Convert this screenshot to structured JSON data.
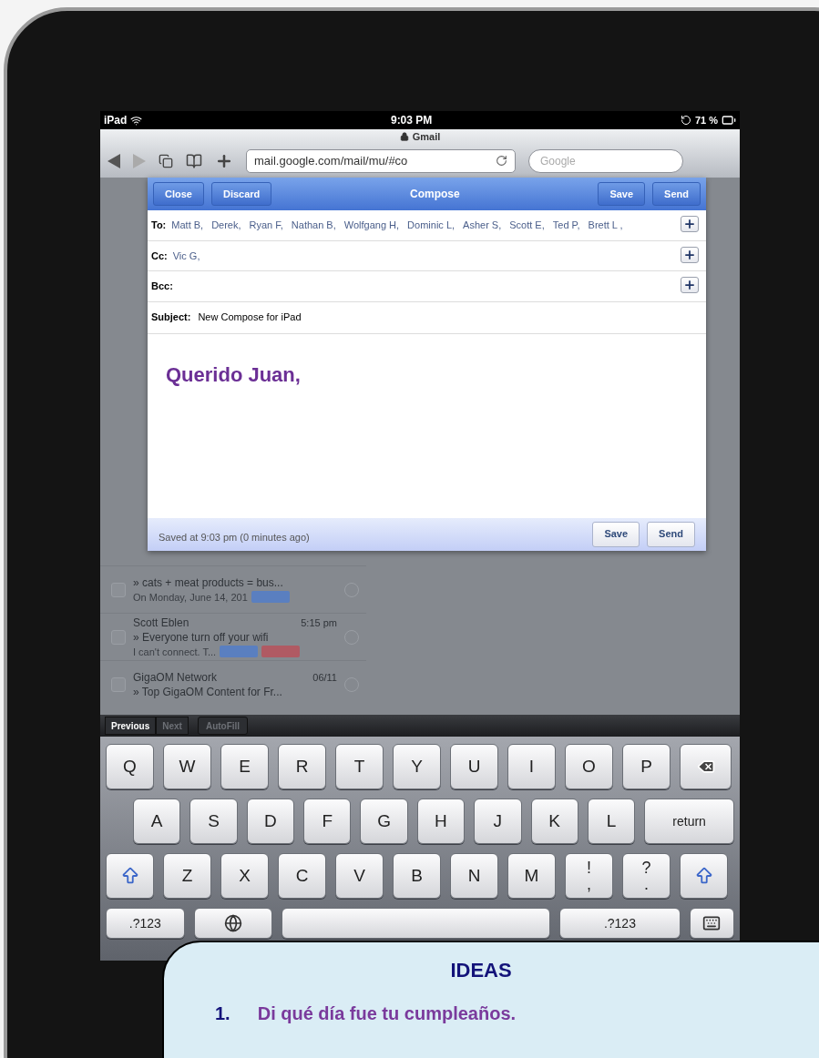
{
  "status_bar": {
    "device": "iPad",
    "time": "9:03 PM",
    "battery": "71 %"
  },
  "browser": {
    "title": "Gmail",
    "url": "mail.google.com/mail/mu/#co",
    "search_placeholder": "Google"
  },
  "compose": {
    "left_buttons": [
      "Close",
      "Discard"
    ],
    "title": "Compose",
    "right_buttons": [
      "Save",
      "Send"
    ],
    "fields": [
      {
        "label": "To:",
        "recipients": [
          "Matt B,",
          "Derek,",
          "Ryan F,",
          "Nathan B,",
          "Wolfgang H,",
          "Dominic L,",
          "Asher S,",
          "Scott E,",
          "Ted P,",
          "Brett L ,"
        ]
      },
      {
        "label": "Cc:",
        "recipients": [
          "Vic G,"
        ]
      },
      {
        "label": "Bcc:"
      }
    ],
    "subject": {
      "label": "Subject:",
      "value": "New Compose for iPad"
    },
    "body": "Querido Juan,",
    "saved_note": "Saved at 9:03 pm (0 minutes ago)",
    "footer_buttons": [
      "Save",
      "Send"
    ]
  },
  "message_list": [
    {
      "checked": false,
      "subject": "» cats + meat products = bus...",
      "snippet": "On Monday, June 14, 201",
      "tags": [
        {
          "color": "#5a7fc0"
        }
      ]
    },
    {
      "checked": false,
      "sender": "Scott Eblen",
      "time": "5:15 pm",
      "subject": "» Everyone turn off your wifi",
      "snippet": "I can't connect. T...",
      "tags": [
        {
          "color": "#5a7fc0"
        },
        {
          "color": "#b05a63"
        }
      ]
    },
    {
      "checked": false,
      "sender": "GigaOM Network",
      "time": "06/11",
      "subject": "» Top GigaOM Content for Fr..."
    }
  ],
  "keyboard_toolbar": [
    {
      "label": "Previous",
      "disabled": false
    },
    {
      "label": "Next",
      "disabled": true
    },
    {
      "label": "AutoFill",
      "disabled": true
    }
  ],
  "keyboard": [
    [
      {
        "kind": "char",
        "label": "Q"
      },
      {
        "kind": "char",
        "label": "W"
      },
      {
        "kind": "char",
        "label": "E"
      },
      {
        "kind": "char",
        "label": "R"
      },
      {
        "kind": "char",
        "label": "T"
      },
      {
        "kind": "char",
        "label": "Y"
      },
      {
        "kind": "char",
        "label": "U"
      },
      {
        "kind": "char",
        "label": "I"
      },
      {
        "kind": "char",
        "label": "O"
      },
      {
        "kind": "char",
        "label": "P"
      },
      {
        "kind": "backspace"
      }
    ],
    [
      {
        "kind": "char",
        "label": "A"
      },
      {
        "kind": "char",
        "label": "S"
      },
      {
        "kind": "char",
        "label": "D"
      },
      {
        "kind": "char",
        "label": "F"
      },
      {
        "kind": "char",
        "label": "G"
      },
      {
        "kind": "char",
        "label": "H"
      },
      {
        "kind": "char",
        "label": "J"
      },
      {
        "kind": "char",
        "label": "K"
      },
      {
        "kind": "char",
        "label": "L"
      },
      {
        "kind": "wide",
        "label": "return"
      }
    ],
    [
      {
        "kind": "shift"
      },
      {
        "kind": "char",
        "label": "Z"
      },
      {
        "kind": "char",
        "label": "X"
      },
      {
        "kind": "char",
        "label": "C"
      },
      {
        "kind": "char",
        "label": "V"
      },
      {
        "kind": "char",
        "label": "B"
      },
      {
        "kind": "char",
        "label": "N"
      },
      {
        "kind": "char",
        "label": "M"
      },
      {
        "kind": "dual",
        "label": "!",
        "sub": ","
      },
      {
        "kind": "dual",
        "label": "?",
        "sub": "."
      },
      {
        "kind": "shift"
      }
    ],
    [
      {
        "kind": "numbers",
        "label": ".?123"
      },
      {
        "kind": "globe"
      },
      {
        "kind": "space"
      },
      {
        "kind": "numbers2",
        "label": ".?123"
      },
      {
        "kind": "hide"
      }
    ]
  ],
  "ideas": {
    "title": "IDEAS",
    "items": [
      {
        "number": "1.",
        "text": "Di qué día fue tu cumpleaños."
      }
    ]
  }
}
